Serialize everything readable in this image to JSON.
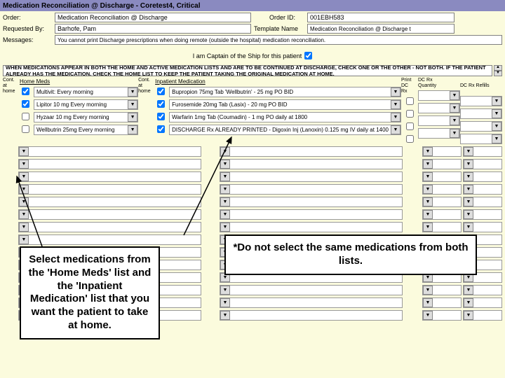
{
  "titlebar": "Medication Reconciliation @ Discharge - Coretest4, Critical",
  "header": {
    "order_label": "Order:",
    "order_value": "Medication Reconciliation @ Discharge",
    "orderid_label": "Order ID:",
    "orderid_value": "001EBH583",
    "requested_label": "Requested By:",
    "requested_value": "Barhofe, Pam",
    "template_label": "Template Name",
    "template_value": "Medication Reconciliation @ Discharge t",
    "messages_label": "Messages:",
    "messages_value": "You cannot print Discharge prescriptions when doing remote (outside the hospital) medication reconciliation."
  },
  "eli": {
    "label": "I am Captain of the Ship for this patient"
  },
  "notice": "WHEN MEDICATIONS APPEAR IN BOTH THE HOME AND ACTIVE MEDICATION LISTS AND ARE TO BE CONTINUED AT DISCHARGE, CHECK ONE OR THE OTHER - NOT BOTH. IF THE PATIENT ALREADY HAS THE MEDICATION, CHECK THE HOME LIST TO KEEP THE PATIENT TAKING THE ORIGINAL MEDICATION AT HOME.",
  "cols": {
    "cont_home": "Cont.\nat\nhome",
    "home_meds": "Home Meds",
    "inpatient": "Inpatient Medication",
    "print_rx": "Print\nDC\nRx",
    "qty": "DC Rx\nQuantity",
    "refills": "DC Rx Refills"
  },
  "home_meds": [
    {
      "checked": true,
      "text": "Multivit: Every morning"
    },
    {
      "checked": true,
      "text": "Lipitor 10 mg Every morning"
    },
    {
      "checked": false,
      "text": "Hyzaar 10 mg Every morning"
    },
    {
      "checked": false,
      "text": "Wellbutrin 25mg Every morning"
    }
  ],
  "inpatient_meds": [
    {
      "checked": true,
      "print": false,
      "text": "Bupropion  75mg Tab 'Wellbutrin' - 25 mg PO BID"
    },
    {
      "checked": true,
      "print": false,
      "text": "Furosemide  20mg Tab (Lasix) - 20 mg PO BID"
    },
    {
      "checked": true,
      "print": false,
      "text": "Warfarin  1mg Tab (Coumadin) - 1 mg PO daily at 1800"
    },
    {
      "checked": true,
      "print": false,
      "text": "DISCHARGE Rx ALREADY PRINTED - Digoxin Inj (Lanoxin)   0.125 mg IV daily at 1400"
    }
  ],
  "annotations": {
    "left": "Select medications from the 'Home Meds' list and the 'Inpatient Medication' list that you want the patient to take at home.",
    "right": "*Do not select the same medications from both lists."
  }
}
